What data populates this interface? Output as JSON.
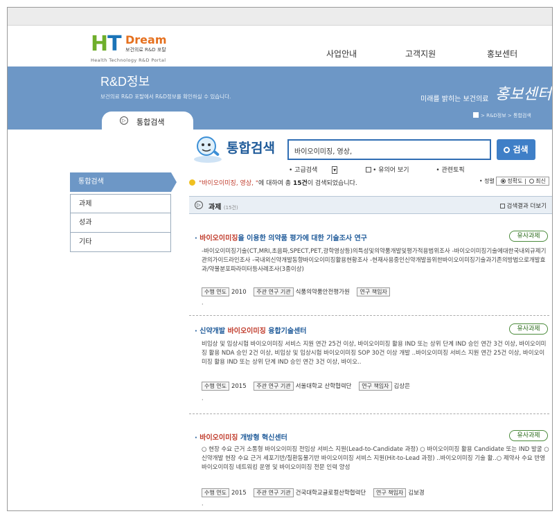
{
  "logo": {
    "ht": "HT",
    "dream": "Dream",
    "sub": "보건의료 R&D 포탈",
    "eng": "Health Technology R&D Portal"
  },
  "gnb": [
    "사업안내",
    "고객지원",
    "홍보센터"
  ],
  "banner": {
    "title": "R&D정보",
    "subtitle": "보건의료 R&D 포탈에서 R&D정보를 확인하실 수 있습니다.",
    "slogan1": "미래를 밝히는 보건의료",
    "slogan2": "홍보센터",
    "breadcrumb": "> R&D정보 > 통합검색",
    "tab_label": "통합검색",
    "tab_icon": "▷"
  },
  "sidebar": [
    "통합검색",
    "과제",
    "성과",
    "기타"
  ],
  "search": {
    "title": "통합검색",
    "query": "바이오이미징, 영상,",
    "button": "검색",
    "opt_advanced": "• 고급검색",
    "opt_synonym": "• 유의어 보기",
    "opt_related": "• 관련토픽"
  },
  "result_line": {
    "keyword": "\"바이오이미징, 영상, \"",
    "mid": "에 대하여 총",
    "count": "15건",
    "tail": "이 검색되었습니다.",
    "sort_label": "• 정렬",
    "sort_accuracy": "정확도",
    "sort_latest": "최신"
  },
  "category": {
    "label": "과제",
    "count": "(15건)",
    "more": "검색결과 더보기"
  },
  "entries": [
    {
      "title_pre": "",
      "title_kw": "바이오이미징",
      "title_post": "을 이용한 의약품 평가에 대한 기술조사 연구",
      "tag": "유사과제",
      "body": "-바이오이미징기술(CT,MRI,초음파,SPECT,PET,광학영상등)의특성및의약품개발및평가적용범위조사 -바이오이미징기술에대한국내외규제기관의가이드라인조사 -국내외신약개발동향바이오이미징활용현황조사 -현재사용중인신약개발을위한바이오이미징기술과기존의방법으로개발효과/약물분포파라미터등사례조사(3종이상)",
      "year_label": "수행 연도",
      "year": "2010",
      "org_label": "주관 연구 기관",
      "org": "식품의약품안전평가원",
      "pi_label": "연구 책임자",
      "pi": ""
    },
    {
      "title_pre": "신약개발 ",
      "title_kw": "바이오이미징",
      "title_post": " 융합기술센터",
      "tag": "유사과제",
      "body": "비임상 및 임상시험 바이오이미징 서비스 지원 연간 25건 이상, 바이오이미징 활용 IND 또는 상위 단계 IND 승인 연간 3건 이상, 바이오이미징 활용 NDA 승인 2건 이상, 비임상 및 임상시험 바이오이미징 SOP 30건 이상 개발 ..바이오이미징 서비스 지원 연간 25건 이상, 바이오이미징 활용 IND 또는 상위 단계 IND 승인 연간 3건 이상, 바이오..",
      "year_label": "수행 연도",
      "year": "2015",
      "org_label": "주관 연구 기관",
      "org": "서울대학교 산학협력단",
      "pi_label": "연구 책임자",
      "pi": "김상은"
    },
    {
      "title_pre": "",
      "title_kw": "바이오이미징",
      "title_post": " 개방형 혁신센터",
      "tag": "유사과제",
      "body": "○ 현장 수요 근거 소통형 바이오이미징 전임상 서비스 지원(Lead-to-Candidate 과정) ○ 바이오이미징 활용 Candidate 또는 IND 발굴 ○ 신약개발 현장 수요 근거 세포기반/질환동물기반 바이오이미징 서비스 지원(Hit-to-Lead 과정) ..바이오이미징 기술 활..○ 제약사 수요 반영 바이오이미징 네트워킹 운영 및 바이오이미징 전문 인력 양성",
      "year_label": "수행 연도",
      "year": "2015",
      "org_label": "주관 연구 기관",
      "org": "건국대학교글로컬산학협력단",
      "pi_label": "연구 책임자",
      "pi": "김보경"
    }
  ],
  "colors": {
    "banner": "#6d97c6",
    "keyword": "#c03b2b",
    "title": "#1e5a99",
    "tag": "#4a8a3a"
  }
}
